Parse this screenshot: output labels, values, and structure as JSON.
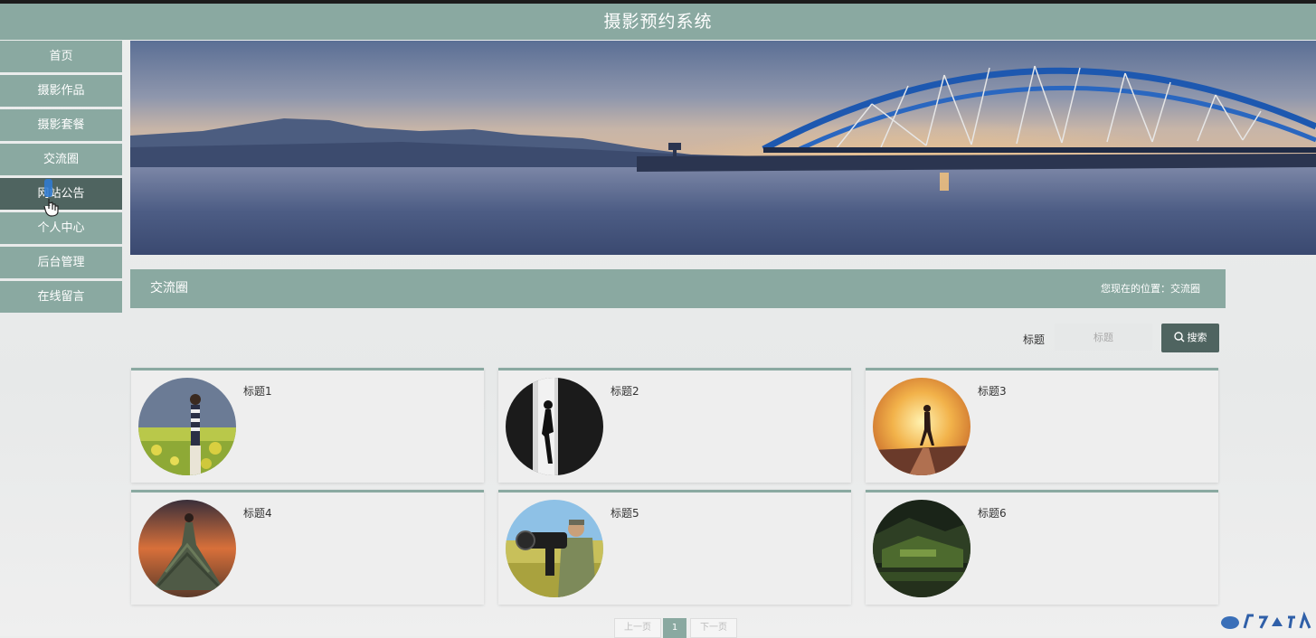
{
  "app": {
    "title": "摄影预约系统"
  },
  "nav": {
    "items": [
      {
        "label": "首页"
      },
      {
        "label": "摄影作品"
      },
      {
        "label": "摄影套餐"
      },
      {
        "label": "交流圈"
      },
      {
        "label": "网站公告"
      },
      {
        "label": "个人中心"
      },
      {
        "label": "后台管理"
      },
      {
        "label": "在线留言"
      }
    ],
    "hovered": "网站公告"
  },
  "section": {
    "title": "交流圈",
    "breadcrumb": "您现在的位置：交流圈"
  },
  "search": {
    "label": "标题",
    "placeholder": "标题",
    "button_label": "搜索"
  },
  "cards": [
    {
      "title": "标题1",
      "image": "woman-in-flower-field-photo"
    },
    {
      "title": "标题2",
      "image": "silhouette-in-doorway-photo"
    },
    {
      "title": "标题3",
      "image": "runner-at-sunset-photo"
    },
    {
      "title": "标题4",
      "image": "dress-at-sunset-photo"
    },
    {
      "title": "标题5",
      "image": "photographer-with-lens-photo"
    },
    {
      "title": "标题6",
      "image": "green-valley-landscape-photo"
    }
  ],
  "pagination": {
    "prev_label": "上一页",
    "current_page": "1",
    "next_label": "下一页"
  },
  "colors": {
    "accent": "#8aa9a1",
    "accent_dark": "#4f6460"
  }
}
